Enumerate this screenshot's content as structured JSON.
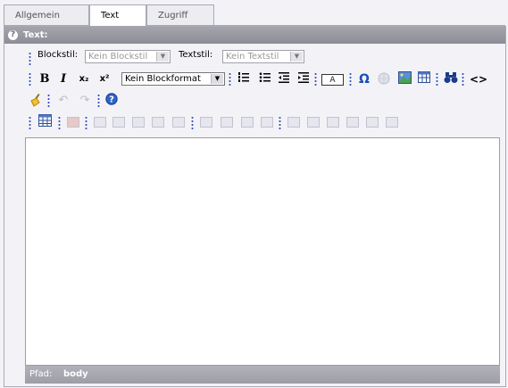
{
  "tabs": [
    {
      "label": "Allgemein"
    },
    {
      "label": "Text"
    },
    {
      "label": "Zugriff"
    }
  ],
  "panel": {
    "title": "Text:"
  },
  "toolbar": {
    "blockstil_label": "Blockstil:",
    "blockstil_value": "Kein Blockstil",
    "textstil_label": "Textstil:",
    "textstil_value": "Kein Textstil",
    "blockformat_value": "Kein Blockformat",
    "bold": "B",
    "italic": "I",
    "subscript": "x₂",
    "superscript": "x²",
    "textcolor": "A",
    "special_char": "Ω",
    "source": "<>"
  },
  "status": {
    "label": "Pfad:",
    "value": "body"
  }
}
